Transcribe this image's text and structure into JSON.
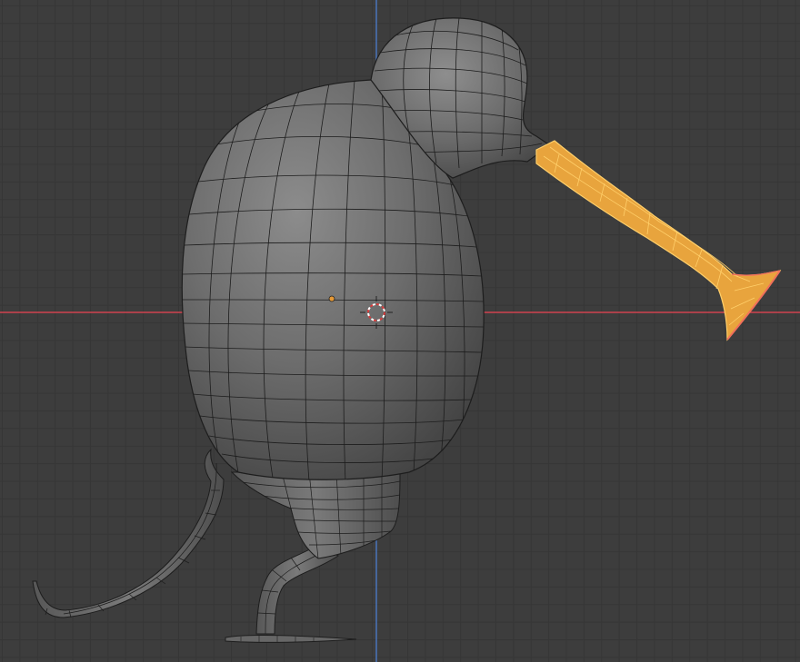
{
  "app": {
    "name": "3D Viewport",
    "mode": "edit-mode"
  },
  "view": {
    "orientation": "side",
    "grid": true,
    "x_axis_color": "#d0434e",
    "z_axis_color": "#4a78c4"
  },
  "scene": {
    "object_semantic": "kiwi-bird-mesh",
    "selected_part": "beak",
    "colors": {
      "background": "#3d3d3d",
      "grid_line": "#363636",
      "mesh_base": "#656565",
      "mesh_highlight": "#8a8a8a",
      "mesh_wire": "#1d1d1d",
      "selection_fill": "#e8a43d",
      "selection_edge": "#ffcf6a",
      "selection_tip": "#f1705a",
      "origin_dot": "#e59937",
      "cursor_red": "#d63c3c"
    }
  }
}
